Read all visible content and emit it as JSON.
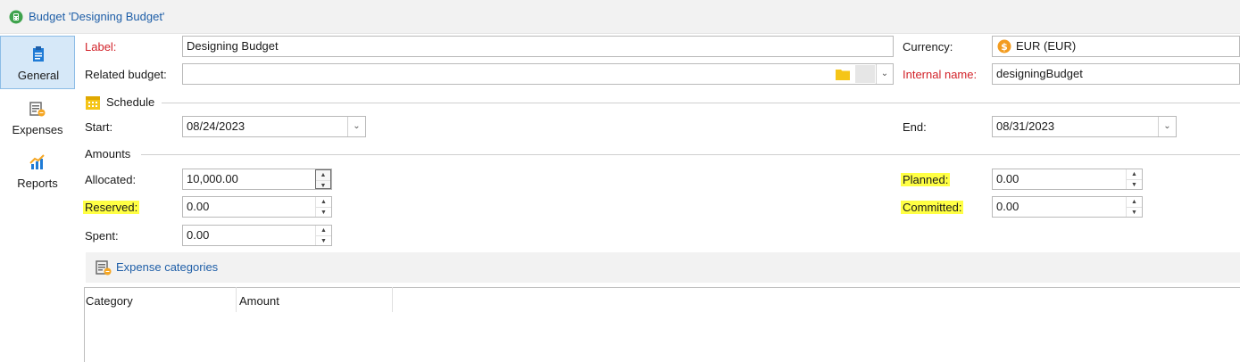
{
  "window": {
    "title": "Budget 'Designing Budget'",
    "title_icon": "budget-icon"
  },
  "sidebar": {
    "items": [
      {
        "label": "General",
        "icon": "clipboard-icon",
        "active": true
      },
      {
        "label": "Expenses",
        "icon": "expenses-icon",
        "active": false
      },
      {
        "label": "Reports",
        "icon": "chart-icon",
        "active": false
      }
    ]
  },
  "form": {
    "label": {
      "label": "Label:",
      "value": "Designing Budget"
    },
    "related_budget": {
      "label": "Related budget:",
      "value": ""
    },
    "currency": {
      "label": "Currency:",
      "value": "EUR (EUR)",
      "icon": "dollar-coin-icon"
    },
    "internal_name": {
      "label": "Internal name:",
      "value": "designingBudget"
    }
  },
  "schedule": {
    "title": "Schedule",
    "start": {
      "label": "Start:",
      "value": "08/24/2023"
    },
    "end": {
      "label": "End:",
      "value": "08/31/2023"
    }
  },
  "amounts": {
    "title": "Amounts",
    "allocated": {
      "label": "Allocated:",
      "value": "10,000.00"
    },
    "reserved": {
      "label": "Reserved:",
      "value": "0.00"
    },
    "spent": {
      "label": "Spent:",
      "value": "0.00"
    },
    "planned": {
      "label": "Planned:",
      "value": "0.00"
    },
    "committed": {
      "label": "Committed:",
      "value": "0.00"
    }
  },
  "expense_categories": {
    "link": "Expense categories",
    "columns": [
      "Category",
      "Amount"
    ]
  },
  "colors": {
    "link": "#1f5fa8",
    "required_label": "#d2232a",
    "highlight": "#ffff44",
    "active_tab": "#d6e8f8"
  }
}
